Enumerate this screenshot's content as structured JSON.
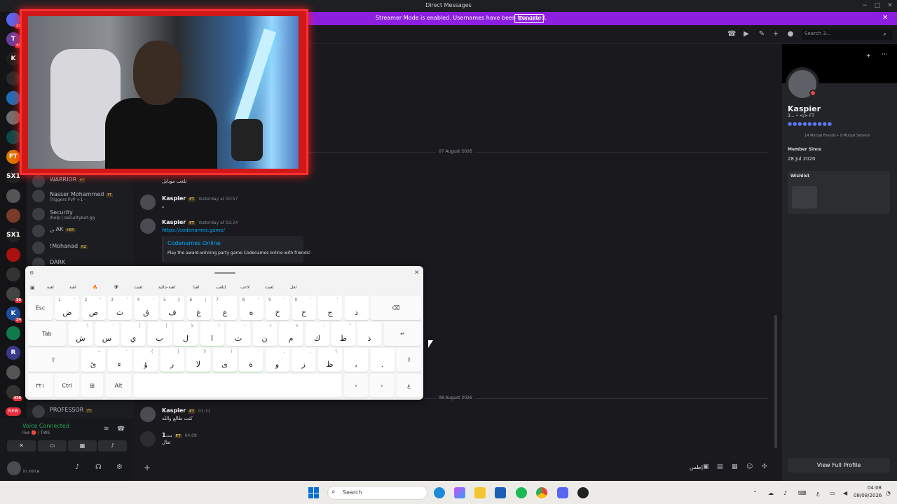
{
  "window": {
    "title": "Direct Messages",
    "controls": [
      "−",
      "□",
      "✕"
    ]
  },
  "banner": {
    "text": "Streamer Mode is enabled. Usernames have been truncated.",
    "button": "Disable"
  },
  "search": {
    "placeholder": "Search 3..."
  },
  "guilds": [
    {
      "label": "",
      "badge": "28",
      "color": "#5865f2"
    },
    {
      "label": "T",
      "badge": "40",
      "color": "#6b3fa0"
    },
    {
      "label": "K",
      "badge": "",
      "color": "#1f1f1f"
    },
    {
      "label": "",
      "badge": "",
      "color": "#2b2b2b"
    },
    {
      "label": "",
      "badge": "",
      "color": "#1e6db5"
    },
    {
      "label": "",
      "badge": "",
      "color": "#707070"
    },
    {
      "label": "",
      "badge": "",
      "color": "#0c4a4a"
    },
    {
      "label": "FT",
      "badge": "",
      "color": "#d97b00"
    },
    {
      "label": "SX1",
      "badge": "",
      "color": "#222"
    },
    {
      "label": "",
      "badge": "",
      "color": "#555"
    },
    {
      "label": "",
      "badge": "",
      "color": "#7a3a2a"
    },
    {
      "label": "SX1",
      "badge": "",
      "color": "#222"
    },
    {
      "label": "",
      "badge": "",
      "color": "#aa1111"
    },
    {
      "label": "",
      "badge": "",
      "color": "#333"
    },
    {
      "label": "",
      "badge": "30",
      "color": "#444"
    },
    {
      "label": "K",
      "badge": "24",
      "color": "#1b4f9c"
    },
    {
      "label": "",
      "badge": "",
      "color": "#117a4a"
    },
    {
      "label": "R",
      "badge": "",
      "color": "#3a3a8a"
    },
    {
      "label": "",
      "badge": "",
      "color": "#555"
    },
    {
      "label": "",
      "badge": "438",
      "color": "#333"
    }
  ],
  "guild_new": "NEW",
  "members": [
    {
      "name": "WARRIOR",
      "tag": "FT",
      "sub": ""
    },
    {
      "name": "Nasser Mohammed",
      "tag": "FT",
      "sub": "Triggers PvP +1 -"
    },
    {
      "name": "Security",
      "tag": "",
      "sub": "/help | securitybot.gg"
    },
    {
      "name": "ﮟ AK",
      "tag": "HER",
      "sub": ""
    },
    {
      "name": "!Mohanad",
      "tag": "RZ",
      "sub": ""
    },
    {
      "name": "DARK",
      "tag": "",
      "sub": ""
    },
    {
      "name": "PROFESSOR",
      "tag": "FT",
      "sub": ""
    }
  ],
  "messages": {
    "date1": "07 August 2026",
    "date2": "08 August 2026",
    "pre_text": "تلعب موبايل",
    "m1": {
      "author": "Kaspier",
      "tag": "FT",
      "time": "Yesterday at 00:57",
      "text": "د"
    },
    "m2": {
      "author": "Kaspier",
      "tag": "FT",
      "time": "Yesterday at 02:24",
      "link": "https://codenames.game/"
    },
    "embed": {
      "title": "Codenames Online",
      "desc": "Play the award-winning party game Codenames online with friends!"
    },
    "m3": {
      "author": "Kaspier",
      "tag": "FT",
      "time": "01:31",
      "text": "كنت طالع والله"
    },
    "m4": {
      "author": "1...",
      "tag": "FT",
      "time": "04:08",
      "text": "تعال"
    }
  },
  "voice": {
    "status": "Voice Connected",
    "channel": "live 🔴 / TWS",
    "user_status": "In voice"
  },
  "composer": {
    "text": "طس|"
  },
  "profile": {
    "name": "Kaspier",
    "sub": "3... • </> FT",
    "mutual": "14 Mutual Friends • 9 Mutual Servers",
    "member_since_label": "Member Since",
    "member_since": "28 Jul 2020",
    "wishlist": "Wishlist",
    "view_full": "View Full Profile"
  },
  "keyboard": {
    "suggestions": [
      "لعبة",
      "لعبة",
      "🔥",
      "🛡",
      "لعبت",
      "لعبة-تنالية",
      "لعبا",
      "لتلعب",
      "لاعب",
      "لعبت",
      "لعل"
    ],
    "row1": [
      {
        "main": "ض",
        "sub": "1",
        "alt": "'"
      },
      {
        "main": "ص",
        "sub": "2",
        "alt": "'"
      },
      {
        "main": "ث",
        "sub": "3",
        "alt": "'"
      },
      {
        "main": "ق",
        "sub": "4",
        "alt": "'"
      },
      {
        "main": "ف",
        "sub": "5",
        "alt": "لإ"
      },
      {
        "main": "غ",
        "sub": "6",
        "alt": "إ"
      },
      {
        "main": "ع",
        "sub": "7",
        "alt": ""
      },
      {
        "main": "ه",
        "sub": "8",
        "alt": "'"
      },
      {
        "main": "خ",
        "sub": "9",
        "alt": "'"
      },
      {
        "main": "ح",
        "sub": "0",
        "alt": "'"
      },
      {
        "main": "ج",
        "sub": "",
        "alt": "'"
      },
      {
        "main": "د",
        "sub": "",
        "alt": ""
      }
    ],
    "row2": [
      {
        "main": "ش",
        "sub": "",
        "alt": "\\"
      },
      {
        "main": "س",
        "sub": "",
        "alt": "'"
      },
      {
        "main": "ي",
        "sub": "",
        "alt": "["
      },
      {
        "main": "ب",
        "sub": "",
        "alt": "]"
      },
      {
        "main": "ل",
        "sub": "",
        "alt": "لأ"
      },
      {
        "main": "ا",
        "sub": "",
        "alt": "أ"
      },
      {
        "main": "ت",
        "sub": "",
        "alt": "-"
      },
      {
        "main": "ن",
        "sub": "",
        "alt": "÷"
      },
      {
        "main": "م",
        "sub": "",
        "alt": "×"
      },
      {
        "main": "ك",
        "sub": "",
        "alt": "؛"
      },
      {
        "main": "ط",
        "sub": "",
        "alt": "\""
      }
    ],
    "row2_extra": "ذ",
    "row3": [
      {
        "main": "ئ",
        "sub": "",
        "alt": "~"
      },
      {
        "main": "ء",
        "sub": "",
        "alt": "'"
      },
      {
        "main": "ؤ",
        "sub": "",
        "alt": "{"
      },
      {
        "main": "ر",
        "sub": "",
        "alt": "}"
      },
      {
        "main": "لا",
        "sub": "",
        "alt": "لآ"
      },
      {
        "main": "ى",
        "sub": "",
        "alt": "آ"
      },
      {
        "main": "ة",
        "sub": "",
        "alt": "'"
      },
      {
        "main": "و",
        "sub": "",
        "alt": ","
      },
      {
        "main": "ز",
        "sub": "",
        "alt": "."
      },
      {
        "main": "ظ",
        "sub": "",
        "alt": "؟"
      },
      {
        "main": "،",
        "sub": "",
        "alt": ""
      },
      {
        "main": ".",
        "sub": "",
        "alt": ""
      }
    ],
    "esc": "Esc",
    "tab": "Tab",
    "numlock": "٣٢١",
    "ctrl": "Ctrl",
    "alt_key": "Alt",
    "lang": "ع"
  },
  "taskbar": {
    "search": "Search",
    "time": "04:08",
    "date": "08/08/2026"
  }
}
